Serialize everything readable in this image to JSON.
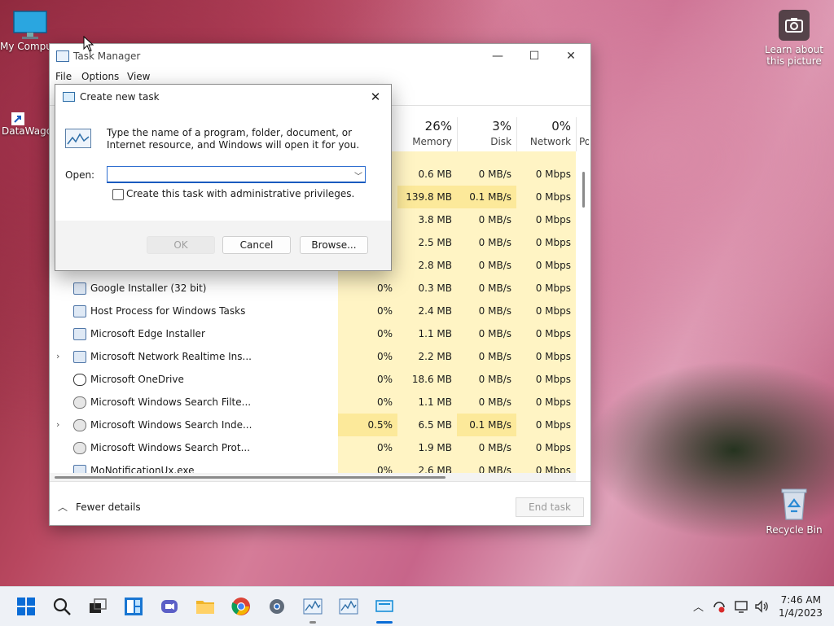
{
  "desktop": {
    "icons": [
      {
        "label": "My Compu",
        "icon": "monitor-icon"
      },
      {
        "label": "DataWagon",
        "icon": "shortcut-icon"
      },
      {
        "label": "Recycle Bin",
        "icon": "recycle-bin-icon"
      }
    ],
    "spotlight": {
      "label_line1": "Learn about",
      "label_line2": "this picture",
      "icon": "camera-icon"
    }
  },
  "task_manager": {
    "title": "Task Manager",
    "menu": [
      "File",
      "Options",
      "View"
    ],
    "columns": [
      {
        "pct": "26%",
        "name": "Memory"
      },
      {
        "pct": "3%",
        "name": "Disk"
      },
      {
        "pct": "0%",
        "name": "Network"
      },
      {
        "pct": "",
        "name": "Po"
      }
    ],
    "partial_rows": [
      {
        "mem": "0.6 MB",
        "disk": "0 MB/s",
        "net": "0 Mbps"
      },
      {
        "mem": "139.8 MB",
        "disk": "0.1 MB/s",
        "net": "0 Mbps"
      },
      {
        "mem": "3.8 MB",
        "disk": "0 MB/s",
        "net": "0 Mbps"
      },
      {
        "mem": "2.5 MB",
        "disk": "0 MB/s",
        "net": "0 Mbps"
      },
      {
        "mem": "2.8 MB",
        "disk": "0 MB/s",
        "net": "0 Mbps"
      }
    ],
    "rows": [
      {
        "expand": "",
        "name": "Google Installer (32 bit)",
        "cpu": "0%",
        "mem": "0.3 MB",
        "disk": "0 MB/s",
        "net": "0 Mbps"
      },
      {
        "expand": "",
        "name": "Host Process for Windows Tasks",
        "cpu": "0%",
        "mem": "2.4 MB",
        "disk": "0 MB/s",
        "net": "0 Mbps"
      },
      {
        "expand": "",
        "name": "Microsoft Edge Installer",
        "cpu": "0%",
        "mem": "1.1 MB",
        "disk": "0 MB/s",
        "net": "0 Mbps"
      },
      {
        "expand": "›",
        "name": "Microsoft Network Realtime Ins...",
        "cpu": "0%",
        "mem": "2.2 MB",
        "disk": "0 MB/s",
        "net": "0 Mbps"
      },
      {
        "expand": "",
        "name": "Microsoft OneDrive",
        "cpu": "0%",
        "mem": "18.6 MB",
        "disk": "0 MB/s",
        "net": "0 Mbps"
      },
      {
        "expand": "",
        "name": "Microsoft Windows Search Filte...",
        "cpu": "0%",
        "mem": "1.1 MB",
        "disk": "0 MB/s",
        "net": "0 Mbps"
      },
      {
        "expand": "›",
        "name": "Microsoft Windows Search Inde...",
        "cpu": "0.5%",
        "mem": "6.5 MB",
        "disk": "0.1 MB/s",
        "net": "0 Mbps"
      },
      {
        "expand": "",
        "name": "Microsoft Windows Search Prot...",
        "cpu": "0%",
        "mem": "1.9 MB",
        "disk": "0 MB/s",
        "net": "0 Mbps"
      },
      {
        "expand": "",
        "name": "MoNotificationUx.exe",
        "cpu": "0%",
        "mem": "2.6 MB",
        "disk": "0 MB/s",
        "net": "0 Mbps"
      }
    ],
    "fewer_details": "Fewer details",
    "end_task": "End task"
  },
  "dialog": {
    "title": "Create new task",
    "description": "Type the name of a program, folder, document, or Internet resource, and Windows will open it for you.",
    "open_label": "Open:",
    "open_value": "",
    "admin_checkbox_label": "Create this task with administrative privileges.",
    "ok": "OK",
    "cancel": "Cancel",
    "browse": "Browse..."
  },
  "taskbar": {
    "icons": [
      "start-icon",
      "search-icon",
      "task-view-icon",
      "widgets-icon",
      "chat-icon",
      "file-explorer-icon",
      "chrome-icon",
      "settings-icon",
      "task-manager-icon",
      "task-manager-icon-2",
      "run-dialog-icon"
    ],
    "time": "7:46 AM",
    "date": "1/4/2023"
  }
}
